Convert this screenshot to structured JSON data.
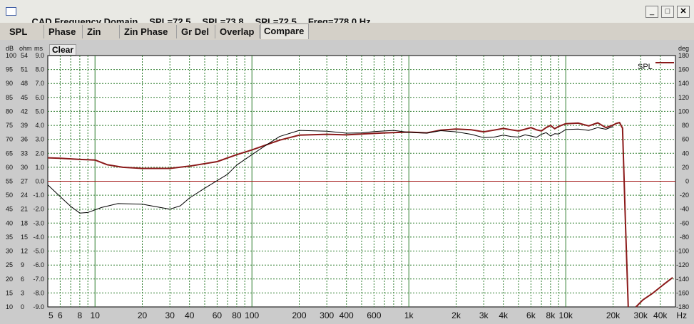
{
  "window": {
    "title_parts": [
      "CAD Frequency Domain",
      "SPL=72.5",
      "SPL=73.8",
      "SPL=72.5",
      "Freq=778.0 Hz"
    ],
    "minimize_glyph": "_",
    "maximize_glyph": "□",
    "close_glyph": "✕"
  },
  "tabs": [
    {
      "label": "SPL",
      "active": false
    },
    {
      "label": "Phase",
      "active": false
    },
    {
      "label": "Zin",
      "active": false
    },
    {
      "label": "Zin Phase",
      "active": false
    },
    {
      "label": "Gr Del",
      "active": false
    },
    {
      "label": "Overlap",
      "active": false
    },
    {
      "label": "Compare",
      "active": true
    }
  ],
  "toolbar": {
    "clear_label": "Clear"
  },
  "colors": {
    "plot_bg": "#ffffff",
    "grid": "#2f7d2f",
    "reference_line": "#a01010",
    "series_spl": "#8b1a1a",
    "series_compare": "#000000",
    "chrome": "#d4d0c8"
  },
  "chart_data": {
    "type": "line",
    "x_scale": "log",
    "x_range": [
      5,
      50000
    ],
    "y_range_db": [
      10,
      100
    ],
    "y_range_deg": [
      -180,
      180
    ],
    "grid": true,
    "legend": {
      "position": "top-right",
      "entries": [
        "SPL"
      ]
    },
    "left_axis_headers": [
      "dB",
      "ohm",
      "ms"
    ],
    "right_axis_header": "deg",
    "x_tick_labels": [
      {
        "v": 5,
        "t": "5"
      },
      {
        "v": 6,
        "t": "6"
      },
      {
        "v": 8,
        "t": "8"
      },
      {
        "v": 10,
        "t": "10"
      },
      {
        "v": 20,
        "t": "20"
      },
      {
        "v": 30,
        "t": "30"
      },
      {
        "v": 40,
        "t": "40"
      },
      {
        "v": 60,
        "t": "60"
      },
      {
        "v": 80,
        "t": "80"
      },
      {
        "v": 100,
        "t": "100"
      },
      {
        "v": 200,
        "t": "200"
      },
      {
        "v": 300,
        "t": "300"
      },
      {
        "v": 400,
        "t": "400"
      },
      {
        "v": 600,
        "t": "600"
      },
      {
        "v": 1000,
        "t": "1k"
      },
      {
        "v": 2000,
        "t": "2k"
      },
      {
        "v": 3000,
        "t": "3k"
      },
      {
        "v": 4000,
        "t": "4k"
      },
      {
        "v": 6000,
        "t": "6k"
      },
      {
        "v": 8000,
        "t": "8k"
      },
      {
        "v": 10000,
        "t": "10k"
      },
      {
        "v": 20000,
        "t": "20k"
      },
      {
        "v": 30000,
        "t": "30k"
      },
      {
        "v": 40000,
        "t": "40k"
      },
      {
        "v": 50000,
        "t": "Hz"
      }
    ],
    "y_ticks_db": [
      "100",
      "95",
      "90",
      "85",
      "80",
      "75",
      "70",
      "65",
      "60",
      "55",
      "50",
      "45",
      "40",
      "35",
      "30",
      "25",
      "20",
      "15",
      "10"
    ],
    "y_ticks_ohm": [
      "54",
      "51",
      "48",
      "45",
      "42",
      "39",
      "36",
      "33",
      "30",
      "27",
      "24",
      "21",
      "18",
      "15",
      "12",
      "9",
      "6",
      "3",
      "0"
    ],
    "y_ticks_ms": [
      "9.0",
      "8.0",
      "7.0",
      "6.0",
      "5.0",
      "4.0",
      "3.0",
      "2.0",
      "1.0",
      "0.0",
      "-1.0",
      "-2.0",
      "-3.0",
      "-4.0",
      "-5.0",
      "-6.0",
      "-7.0",
      "-8.0",
      "-9.0"
    ],
    "y_ticks_deg": [
      "180",
      "160",
      "140",
      "120",
      "100",
      "80",
      "60",
      "40",
      "20",
      "0",
      "-20",
      "-40",
      "-60",
      "-80",
      "-100",
      "-120",
      "-140",
      "-160",
      "-180"
    ],
    "reference_line_db": 55,
    "series": [
      {
        "name": "SPL",
        "color": "#8b1a1a",
        "points": [
          [
            5,
            63.4
          ],
          [
            6,
            63.2
          ],
          [
            8,
            62.8
          ],
          [
            10,
            62.6
          ],
          [
            12,
            60.9
          ],
          [
            15,
            60.0
          ],
          [
            20,
            59.6
          ],
          [
            30,
            59.6
          ],
          [
            40,
            60.4
          ],
          [
            60,
            62.0
          ],
          [
            80,
            64.5
          ],
          [
            100,
            66.2
          ],
          [
            150,
            69.7
          ],
          [
            200,
            71.5
          ],
          [
            300,
            71.8
          ],
          [
            400,
            71.6
          ],
          [
            500,
            71.9
          ],
          [
            700,
            72.3
          ],
          [
            1000,
            72.6
          ],
          [
            1300,
            72.3
          ],
          [
            1600,
            73.3
          ],
          [
            2000,
            73.7
          ],
          [
            2500,
            73.4
          ],
          [
            3000,
            72.7
          ],
          [
            3500,
            73.3
          ],
          [
            4000,
            73.9
          ],
          [
            4500,
            73.4
          ],
          [
            5000,
            73.0
          ],
          [
            5500,
            73.6
          ],
          [
            6000,
            74.2
          ],
          [
            6500,
            73.4
          ],
          [
            7000,
            73.0
          ],
          [
            7500,
            74.2
          ],
          [
            8000,
            75.0
          ],
          [
            8500,
            73.8
          ],
          [
            9000,
            74.6
          ],
          [
            10000,
            75.6
          ],
          [
            12000,
            75.8
          ],
          [
            14000,
            74.8
          ],
          [
            16000,
            75.9
          ],
          [
            18000,
            74.2
          ],
          [
            20000,
            75.1
          ],
          [
            21000,
            75.7
          ],
          [
            22000,
            76.0
          ],
          [
            23000,
            74.0
          ],
          [
            24000,
            40
          ],
          [
            25000,
            10
          ]
        ]
      },
      {
        "name": "",
        "color": "#000000",
        "points": [
          [
            5,
            53.7
          ],
          [
            6,
            49.5
          ],
          [
            7,
            46.0
          ],
          [
            8,
            43.6
          ],
          [
            9,
            43.8
          ],
          [
            11,
            45.6
          ],
          [
            14,
            47.0
          ],
          [
            20,
            46.8
          ],
          [
            25,
            45.8
          ],
          [
            30,
            45.0
          ],
          [
            35,
            46.2
          ],
          [
            40,
            49.0
          ],
          [
            50,
            52.5
          ],
          [
            60,
            55.2
          ],
          [
            70,
            57.5
          ],
          [
            80,
            60.8
          ],
          [
            100,
            64.5
          ],
          [
            120,
            67.5
          ],
          [
            150,
            71.0
          ],
          [
            200,
            73.2
          ],
          [
            300,
            72.9
          ],
          [
            400,
            72.2
          ],
          [
            500,
            72.3
          ],
          [
            600,
            72.8
          ],
          [
            800,
            73.2
          ],
          [
            1000,
            72.5
          ],
          [
            1300,
            72.2
          ],
          [
            1600,
            73.1
          ],
          [
            2000,
            72.7
          ],
          [
            2500,
            71.8
          ],
          [
            3000,
            70.6
          ],
          [
            3500,
            70.8
          ],
          [
            4000,
            71.5
          ],
          [
            4500,
            71.0
          ],
          [
            5000,
            70.8
          ],
          [
            5500,
            71.6
          ],
          [
            6000,
            71.2
          ],
          [
            6500,
            70.7
          ],
          [
            7000,
            71.8
          ],
          [
            7500,
            72.4
          ],
          [
            8000,
            71.2
          ],
          [
            8500,
            72.0
          ],
          [
            9000,
            71.9
          ],
          [
            10000,
            73.5
          ],
          [
            12000,
            73.7
          ],
          [
            14000,
            73.2
          ],
          [
            16000,
            74.2
          ],
          [
            18000,
            73.6
          ],
          [
            20000,
            74.6
          ]
        ]
      },
      {
        "name": "",
        "color": "#8b1a1a",
        "axis": "deg",
        "points": [
          [
            28000,
            -180
          ],
          [
            31000,
            -170
          ],
          [
            36000,
            -160
          ],
          [
            42000,
            -148
          ],
          [
            48000,
            -138
          ]
        ]
      }
    ]
  }
}
